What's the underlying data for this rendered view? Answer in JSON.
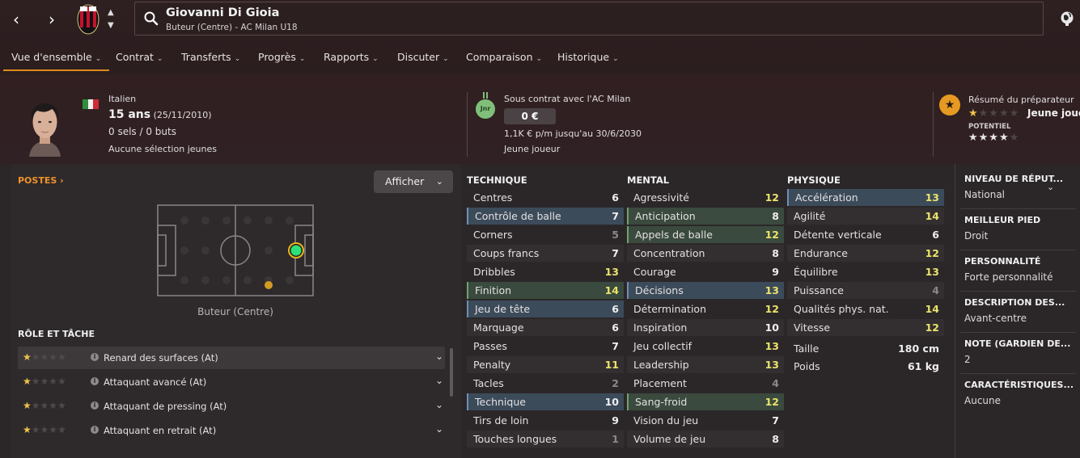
{
  "nav": {
    "back": "‹",
    "forward": "›"
  },
  "player": {
    "name": "Giovanni Di Gioia",
    "subtitle": "Buteur (Centre) - AC Milan U18"
  },
  "tabs": [
    "Vue d'ensemble",
    "Contrat",
    "Transferts",
    "Progrès",
    "Rapports",
    "Discuter",
    "Comparaison",
    "Historique"
  ],
  "overview": {
    "nationality": "Italien",
    "age": "15 ans",
    "birth": "(25/11/2010)",
    "caps": "0 sels / 0 buts",
    "youth": "Aucune sélection jeunes"
  },
  "contract": {
    "badge": "Jnr",
    "title": "Sous contrat avec l'AC Milan",
    "value": "0 €",
    "wage": "1,1K € p/m jusqu'au 30/6/2030",
    "type": "Jeune joueur"
  },
  "coach": {
    "title": "Résumé du préparateur",
    "label": "Jeune joue",
    "potential_label": "POTENTIEL",
    "current_stars": 1,
    "potential_stars": 3.5
  },
  "positions": {
    "title": "POSTES",
    "button": "Afficher",
    "label": "Buteur (Centre)"
  },
  "roles": {
    "title": "RÔLE ET TÂCHE",
    "items": [
      {
        "name": "Renard des surfaces (At)",
        "stars": 1
      },
      {
        "name": "Attaquant avancé (At)",
        "stars": 1
      },
      {
        "name": "Attaquant de pressing (At)",
        "stars": 1
      },
      {
        "name": "Attaquant en retrait (At)",
        "stars": 1
      }
    ]
  },
  "technique": {
    "title": "TECHNIQUE",
    "items": [
      {
        "name": "Centres",
        "value": "6"
      },
      {
        "name": "Contrôle de balle",
        "value": "7",
        "hl": "blue"
      },
      {
        "name": "Corners",
        "value": "5"
      },
      {
        "name": "Coups francs",
        "value": "7"
      },
      {
        "name": "Dribbles",
        "value": "13"
      },
      {
        "name": "Finition",
        "value": "14",
        "hl": "green"
      },
      {
        "name": "Jeu de tête",
        "value": "6",
        "hl": "blue"
      },
      {
        "name": "Marquage",
        "value": "6"
      },
      {
        "name": "Passes",
        "value": "7"
      },
      {
        "name": "Penalty",
        "value": "11"
      },
      {
        "name": "Tacles",
        "value": "2"
      },
      {
        "name": "Technique",
        "value": "10",
        "hl": "blue"
      },
      {
        "name": "Tirs de loin",
        "value": "9"
      },
      {
        "name": "Touches longues",
        "value": "1"
      }
    ]
  },
  "mental": {
    "title": "MENTAL",
    "items": [
      {
        "name": "Agressivité",
        "value": "12"
      },
      {
        "name": "Anticipation",
        "value": "8",
        "hl": "green"
      },
      {
        "name": "Appels de balle",
        "value": "12",
        "hl": "green"
      },
      {
        "name": "Concentration",
        "value": "8"
      },
      {
        "name": "Courage",
        "value": "9"
      },
      {
        "name": "Décisions",
        "value": "13",
        "hl": "blue"
      },
      {
        "name": "Détermination",
        "value": "12"
      },
      {
        "name": "Inspiration",
        "value": "10"
      },
      {
        "name": "Jeu collectif",
        "value": "13"
      },
      {
        "name": "Leadership",
        "value": "13"
      },
      {
        "name": "Placement",
        "value": "4"
      },
      {
        "name": "Sang-froid",
        "value": "12",
        "hl": "green"
      },
      {
        "name": "Vision du jeu",
        "value": "7"
      },
      {
        "name": "Volume de jeu",
        "value": "8"
      }
    ]
  },
  "physique": {
    "title": "PHYSIQUE",
    "items": [
      {
        "name": "Accélération",
        "value": "13",
        "hl": "blue"
      },
      {
        "name": "Agilité",
        "value": "14"
      },
      {
        "name": "Détente verticale",
        "value": "6"
      },
      {
        "name": "Endurance",
        "value": "12"
      },
      {
        "name": "Équilibre",
        "value": "13"
      },
      {
        "name": "Puissance",
        "value": "4"
      },
      {
        "name": "Qualités phys. nat.",
        "value": "14"
      },
      {
        "name": "Vitesse",
        "value": "12"
      }
    ],
    "height_label": "Taille",
    "height": "180 cm",
    "weight_label": "Poids",
    "weight": "61 kg"
  },
  "info": [
    {
      "title": "NIVEAU DE RÉPUT...",
      "value": "National"
    },
    {
      "title": "MEILLEUR PIED",
      "value": "Droit"
    },
    {
      "title": "PERSONNALITÉ",
      "value": "Forte personnalité"
    },
    {
      "title": "DESCRIPTION DES...",
      "value": "Avant-centre"
    },
    {
      "title": "NOTE (GARDIEN DE...",
      "value": "2"
    },
    {
      "title": "CARACTÉRISTIQUES...",
      "value": "Aucune"
    }
  ],
  "colors": {
    "accent": "#e28a1d",
    "star": "#f1c24a",
    "highlight_blue": "#3c4b5a",
    "highlight_green": "#3a4a3e"
  }
}
